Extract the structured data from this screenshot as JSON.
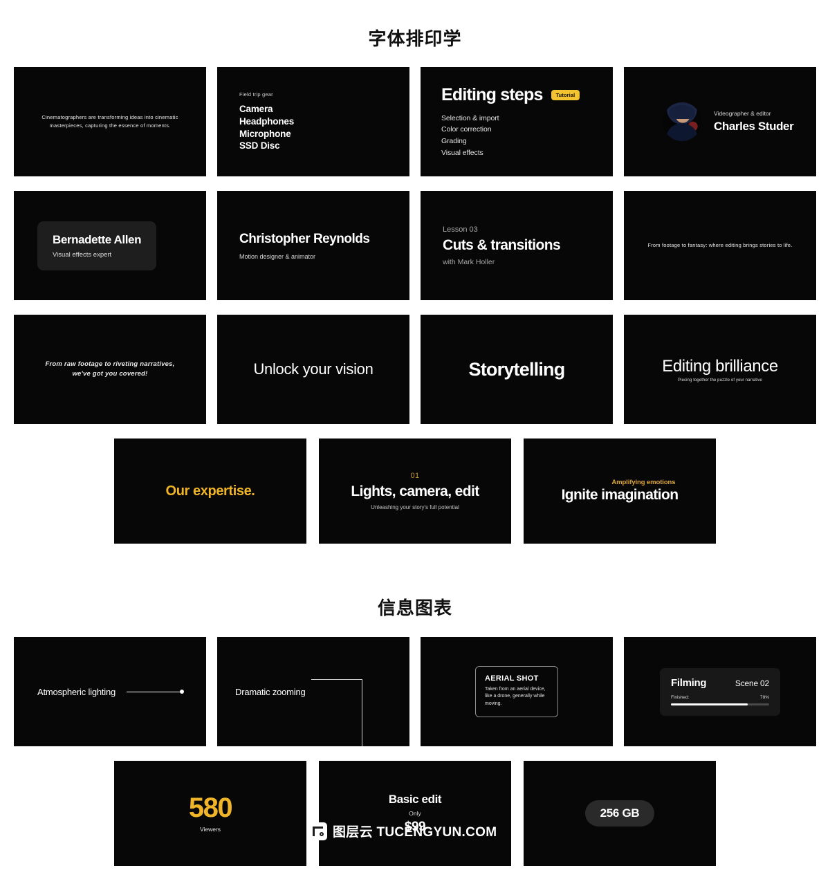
{
  "sections": [
    {
      "title": "字体排印学",
      "cards_row1": [
        {
          "kind": "paragraph",
          "text": "Cinematographers are transforming ideas into cinematic masterpieces, capturing the essence of moments."
        },
        {
          "kind": "list",
          "eyebrow": "Field trip gear",
          "items": [
            "Camera",
            "Headphones",
            "Microphone",
            "SSD Disc"
          ]
        },
        {
          "kind": "steps",
          "title": "Editing steps",
          "badge": "Tutorial",
          "badge_color": "#f4c430",
          "items": [
            "Selection & import",
            "Color correction",
            "Grading",
            "Visual effects"
          ]
        },
        {
          "kind": "profile",
          "avatar_name": "avatar-charles-studer",
          "role": "Videographer & editor",
          "name": "Charles Studer"
        }
      ],
      "cards_row2": [
        {
          "kind": "plate",
          "name": "Bernadette Allen",
          "sub": "Visual effects expert"
        },
        {
          "kind": "namecard",
          "name": "Christopher Reynolds",
          "sub": "Motion designer & animator"
        },
        {
          "kind": "lesson",
          "eyebrow": "Lesson 03",
          "title": "Cuts & transitions",
          "with": "with Mark Holler"
        },
        {
          "kind": "paragraph-one",
          "text": "From footage to fantasy: where editing brings stories to life."
        }
      ],
      "cards_row3": [
        {
          "kind": "italic",
          "line1": "From raw footage to riveting narratives,",
          "line2": "we've got you covered!"
        },
        {
          "kind": "hero-light",
          "text": "Unlock your vision"
        },
        {
          "kind": "hero-bold",
          "text": "Storytelling"
        },
        {
          "kind": "hero-caption",
          "title": "Editing brilliance",
          "caption": "Piecing together the puzzle of your narrative"
        }
      ],
      "cards_row4": [
        {
          "kind": "gold-title",
          "text": "Our expertise.",
          "color": "#f0b428"
        },
        {
          "kind": "numbered",
          "number": "01",
          "title": "Lights, camera, edit",
          "sub": "Unleashing your story's full potential",
          "number_color": "#c99a3a"
        },
        {
          "kind": "amplify",
          "eyebrow": "Amplifying emotions",
          "title": "Ignite imagination",
          "eyebrow_color": "#e0a93a"
        }
      ]
    },
    {
      "title": "信息图表",
      "cards_row1": [
        {
          "kind": "leader-line",
          "label": "Atmospheric lighting",
          "marker": "line-dot-marker"
        },
        {
          "kind": "elbow-line",
          "label": "Dramatic zooming",
          "marker": "elbow-connector"
        },
        {
          "kind": "tipbox",
          "title": "AERIAL SHOT",
          "body": "Taken from an aerial device, like a drone, generally while moving."
        },
        {
          "kind": "progress",
          "title": "Filming",
          "scene": "Scene 02",
          "label": "Finished:",
          "percent": "78%",
          "percent_value": 78
        }
      ],
      "cards_row2": [
        {
          "kind": "stat",
          "value": "580",
          "caption": "Viewers",
          "color": "#f0b428"
        },
        {
          "kind": "price",
          "title": "Basic edit",
          "only": "Only",
          "value": "$99"
        },
        {
          "kind": "pill",
          "text": "256 GB"
        }
      ]
    }
  ],
  "watermark": {
    "logo_name": "tucengyun-logo-icon",
    "text": "图层云 TUCENGYUN.COM"
  }
}
